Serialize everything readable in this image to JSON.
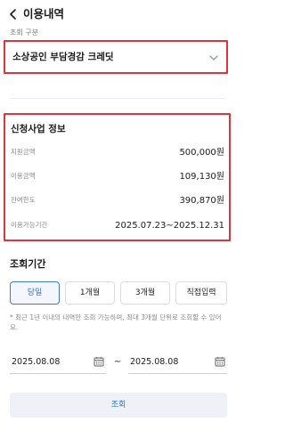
{
  "header": {
    "title": "이용내역"
  },
  "filter": {
    "label": "조회 구분",
    "selected": "소상공인 부담경감 크레딧"
  },
  "info": {
    "title": "신청사업 정보",
    "rows": [
      {
        "key": "지원금액",
        "value": "500,000원"
      },
      {
        "key": "이용금액",
        "value": "109,130원"
      },
      {
        "key": "잔여한도",
        "value": "390,870원"
      },
      {
        "key": "이용가능기간",
        "value": "2025.07.23~2025.12.31"
      }
    ]
  },
  "period": {
    "title": "조회기간",
    "options": [
      {
        "label": "당일",
        "active": true
      },
      {
        "label": "1개월",
        "active": false
      },
      {
        "label": "3개월",
        "active": false
      },
      {
        "label": "직접입력",
        "active": false
      }
    ],
    "notice": "* 최근 1년 이내의 내역만 조회 가능하며, 최대 3개월 단위로 조회할 수 있어요.",
    "start_date": "2025.08.08",
    "separator": "~",
    "end_date": "2025.08.08"
  },
  "search_label": "조회",
  "colors": {
    "accent": "#2f6fd0",
    "highlight_border": "#e0343b"
  }
}
